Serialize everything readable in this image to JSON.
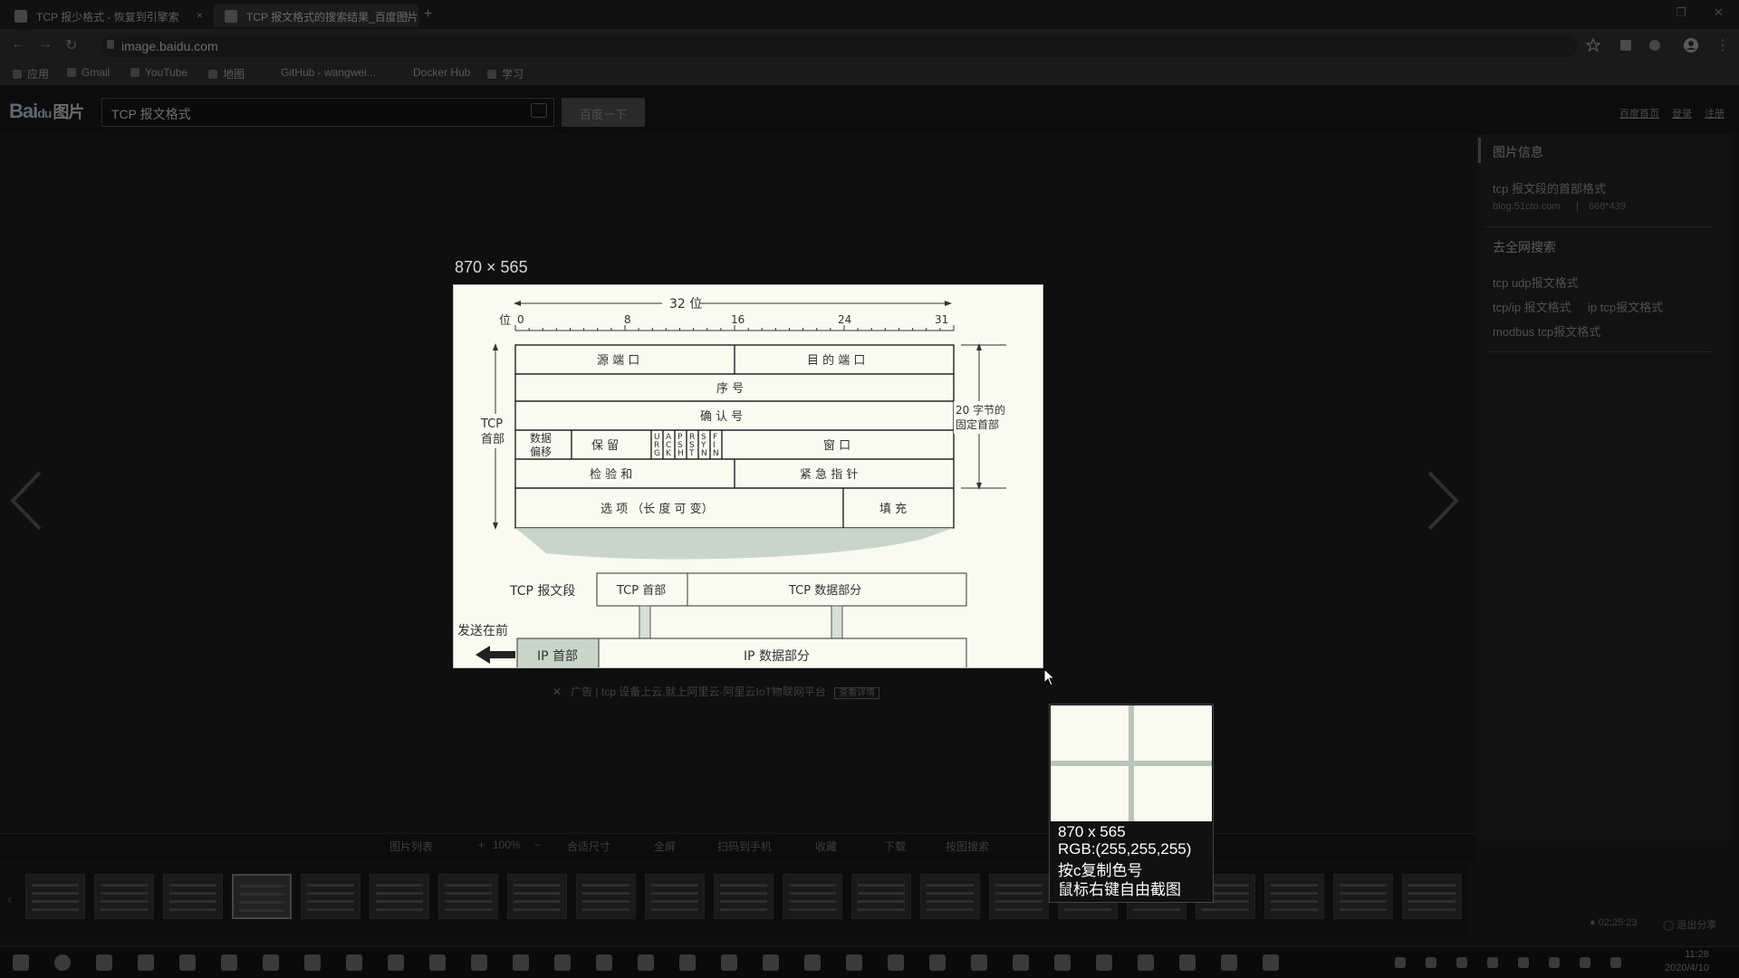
{
  "browser": {
    "tabs": [
      {
        "title": "TCP 报少格式 - 恢复到引擎索"
      },
      {
        "title": "TCP 报文格式的搜索结果_百度图片"
      }
    ],
    "new_tab": "+",
    "url": "image.baidu.com",
    "bookmarks": [
      "应用",
      "Gmail",
      "YouTube",
      "地图",
      "GitHub - wangwei...",
      "Docker Hub",
      "学习"
    ]
  },
  "header": {
    "logo_text": "Bai",
    "logo_paw": "du",
    "logo_cn": "图片",
    "search_value": "TCP 报文格式",
    "search_button": "百度一下",
    "links": [
      "百度首页",
      "登录",
      "注册"
    ]
  },
  "side_panel": {
    "info_title": "图片信息",
    "image_title": "tcp 报文段的首部格式",
    "image_source": "blog.51cto.com",
    "image_dims": "668*439",
    "search_title": "去全网搜索",
    "related": [
      "tcp udp报文格式",
      "tcp/ip 报文格式",
      "ip tcp报文格式",
      "modbus tcp报文格式"
    ]
  },
  "viewer": {
    "size_tag": "870 × 565",
    "ad_text": "广告 | tcp  设备上云,就上阿里云-阿里云IoT物联网平台",
    "ad_button": "查看详情",
    "toolbar": [
      "图片列表",
      "100%",
      "合适尺寸",
      "全屏",
      "扫码到手机",
      "收藏",
      "下载",
      "按图搜索"
    ],
    "timer": "02:25:23",
    "share": "退出分享"
  },
  "diagram": {
    "bits_label": "32 位",
    "bit_unit": "位",
    "ticks": [
      "0",
      "8",
      "16",
      "24",
      "31"
    ],
    "row1": [
      "源 端 口",
      "目 的 端 口"
    ],
    "row2": "序 号",
    "row3": "确 认 号",
    "row4_offset": [
      "数据",
      "偏移"
    ],
    "row4_reserved": "保 留",
    "flags": [
      "URG",
      "ACK",
      "PSH",
      "RST",
      "SYN",
      "FIN"
    ],
    "row4_window": "窗 口",
    "row5": [
      "检 验 和",
      "紧 急 指 针"
    ],
    "row6": [
      "选 项 （长 度 可 变）",
      "填 充"
    ],
    "left_label": [
      "TCP",
      "首部"
    ],
    "right_label": [
      "20 字节的",
      "固定首部"
    ],
    "segment_label": "TCP 报文段",
    "tcp_header_box": "TCP 首部",
    "tcp_data_box": "TCP 数据部分",
    "send_first": "发送在前",
    "ip_header_box": "IP 首部",
    "ip_data_box": "IP 数据部分"
  },
  "magnifier": {
    "size": "870 x 565",
    "rgb": "RGB:(255,255,255)",
    "hint1": "按c复制色号",
    "hint2": "鼠标右键自由截图"
  },
  "taskbar": {
    "time": "11:28",
    "date": "2020/4/10"
  }
}
